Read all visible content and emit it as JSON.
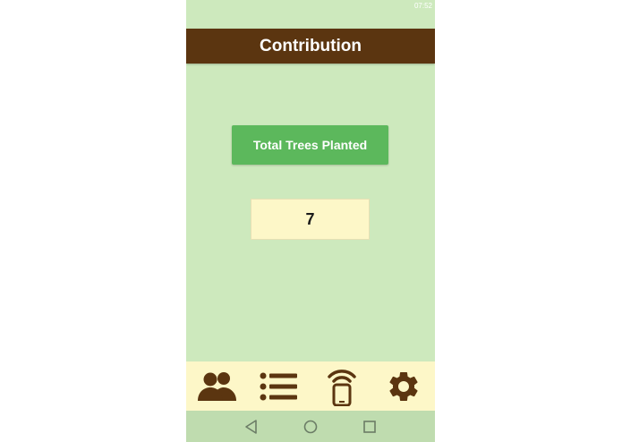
{
  "status_bar": {
    "time": "07:52"
  },
  "app_bar": {
    "title": "Contribution"
  },
  "main": {
    "total_button_label": "Total Trees Planted",
    "total_count": "7"
  },
  "bottom_nav": {
    "items": [
      {
        "icon": "people-icon"
      },
      {
        "icon": "list-icon"
      },
      {
        "icon": "nfc-phone-icon"
      },
      {
        "icon": "gear-icon"
      }
    ]
  },
  "system_nav": {
    "items": [
      {
        "icon": "back-triangle-icon"
      },
      {
        "icon": "home-circle-icon"
      },
      {
        "icon": "recents-square-icon"
      }
    ]
  },
  "colors": {
    "background": "#cde9bd",
    "app_bar": "#5b3510",
    "button": "#5cb85c",
    "count_box": "#fdf7c8",
    "bottom_nav": "#fdf7c8",
    "icon": "#5b3510"
  }
}
